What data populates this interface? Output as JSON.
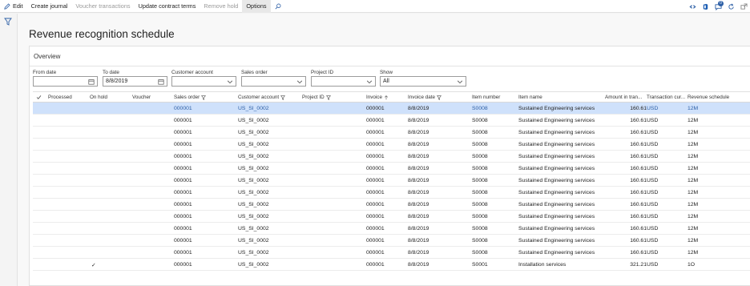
{
  "actionbar": {
    "edit": "Edit",
    "create_journal": "Create journal",
    "voucher_transactions": "Voucher transactions",
    "update_contract_terms": "Update contract terms",
    "remove_hold": "Remove hold",
    "options": "Options",
    "notification_count": "0"
  },
  "page": {
    "title": "Revenue recognition schedule",
    "section": "Overview"
  },
  "filters": {
    "from_date_label": "From date",
    "from_date_value": "",
    "to_date_label": "To date",
    "to_date_value": "8/8/2019",
    "customer_account_label": "Customer account",
    "customer_account_value": "",
    "sales_order_label": "Sales order",
    "sales_order_value": "",
    "project_id_label": "Project ID",
    "project_id_value": "",
    "show_label": "Show",
    "show_value": "All"
  },
  "grid": {
    "headers": {
      "processed": "Processed",
      "on_hold": "On hold",
      "voucher": "Voucher",
      "sales_order": "Sales order",
      "customer_account": "Customer account",
      "project_id": "Project ID",
      "invoice": "Invoice",
      "invoice_date": "Invoice date",
      "item_number": "Item number",
      "item_name": "Item name",
      "amount": "Amount in tran...",
      "currency": "Transaction cur...",
      "revenue_schedule": "Revenue schedule"
    },
    "rows": [
      {
        "on_hold": "",
        "sales_order": "000001",
        "customer_account": "US_SI_0002",
        "invoice": "000001",
        "invoice_date": "8/8/2019",
        "item_number": "S0008",
        "item_name": "Sustained Engineering services",
        "amount": "160.61",
        "currency": "USD",
        "revenue_schedule": "12M"
      },
      {
        "on_hold": "",
        "sales_order": "000001",
        "customer_account": "US_SI_0002",
        "invoice": "000001",
        "invoice_date": "8/8/2019",
        "item_number": "S0008",
        "item_name": "Sustained Engineering services",
        "amount": "160.61",
        "currency": "USD",
        "revenue_schedule": "12M"
      },
      {
        "on_hold": "",
        "sales_order": "000001",
        "customer_account": "US_SI_0002",
        "invoice": "000001",
        "invoice_date": "8/8/2019",
        "item_number": "S0008",
        "item_name": "Sustained Engineering services",
        "amount": "160.61",
        "currency": "USD",
        "revenue_schedule": "12M"
      },
      {
        "on_hold": "",
        "sales_order": "000001",
        "customer_account": "US_SI_0002",
        "invoice": "000001",
        "invoice_date": "8/8/2019",
        "item_number": "S0008",
        "item_name": "Sustained Engineering services",
        "amount": "160.61",
        "currency": "USD",
        "revenue_schedule": "12M"
      },
      {
        "on_hold": "",
        "sales_order": "000001",
        "customer_account": "US_SI_0002",
        "invoice": "000001",
        "invoice_date": "8/8/2019",
        "item_number": "S0008",
        "item_name": "Sustained Engineering services",
        "amount": "160.61",
        "currency": "USD",
        "revenue_schedule": "12M"
      },
      {
        "on_hold": "",
        "sales_order": "000001",
        "customer_account": "US_SI_0002",
        "invoice": "000001",
        "invoice_date": "8/8/2019",
        "item_number": "S0008",
        "item_name": "Sustained Engineering services",
        "amount": "160.61",
        "currency": "USD",
        "revenue_schedule": "12M"
      },
      {
        "on_hold": "",
        "sales_order": "000001",
        "customer_account": "US_SI_0002",
        "invoice": "000001",
        "invoice_date": "8/8/2019",
        "item_number": "S0008",
        "item_name": "Sustained Engineering services",
        "amount": "160.61",
        "currency": "USD",
        "revenue_schedule": "12M"
      },
      {
        "on_hold": "",
        "sales_order": "000001",
        "customer_account": "US_SI_0002",
        "invoice": "000001",
        "invoice_date": "8/8/2019",
        "item_number": "S0008",
        "item_name": "Sustained Engineering services",
        "amount": "160.61",
        "currency": "USD",
        "revenue_schedule": "12M"
      },
      {
        "on_hold": "",
        "sales_order": "000001",
        "customer_account": "US_SI_0002",
        "invoice": "000001",
        "invoice_date": "8/8/2019",
        "item_number": "S0008",
        "item_name": "Sustained Engineering services",
        "amount": "160.61",
        "currency": "USD",
        "revenue_schedule": "12M"
      },
      {
        "on_hold": "",
        "sales_order": "000001",
        "customer_account": "US_SI_0002",
        "invoice": "000001",
        "invoice_date": "8/8/2019",
        "item_number": "S0008",
        "item_name": "Sustained Engineering services",
        "amount": "160.61",
        "currency": "USD",
        "revenue_schedule": "12M"
      },
      {
        "on_hold": "",
        "sales_order": "000001",
        "customer_account": "US_SI_0002",
        "invoice": "000001",
        "invoice_date": "8/8/2019",
        "item_number": "S0008",
        "item_name": "Sustained Engineering services",
        "amount": "160.61",
        "currency": "USD",
        "revenue_schedule": "12M"
      },
      {
        "on_hold": "",
        "sales_order": "000001",
        "customer_account": "US_SI_0002",
        "invoice": "000001",
        "invoice_date": "8/8/2019",
        "item_number": "S0008",
        "item_name": "Sustained Engineering services",
        "amount": "160.61",
        "currency": "USD",
        "revenue_schedule": "12M"
      },
      {
        "on_hold": "",
        "sales_order": "000001",
        "customer_account": "US_SI_0002",
        "invoice": "000001",
        "invoice_date": "8/8/2019",
        "item_number": "S0008",
        "item_name": "Sustained Engineering services",
        "amount": "160.61",
        "currency": "USD",
        "revenue_schedule": "12M"
      },
      {
        "on_hold": "✓",
        "sales_order": "000001",
        "customer_account": "US_SI_0002",
        "invoice": "000001",
        "invoice_date": "8/8/2019",
        "item_number": "S0001",
        "item_name": "Installation services",
        "amount": "321.21",
        "currency": "USD",
        "revenue_schedule": "1O"
      }
    ]
  },
  "colors": {
    "accent": "#2d5fa6",
    "selected_row": "#cfe1fb"
  }
}
